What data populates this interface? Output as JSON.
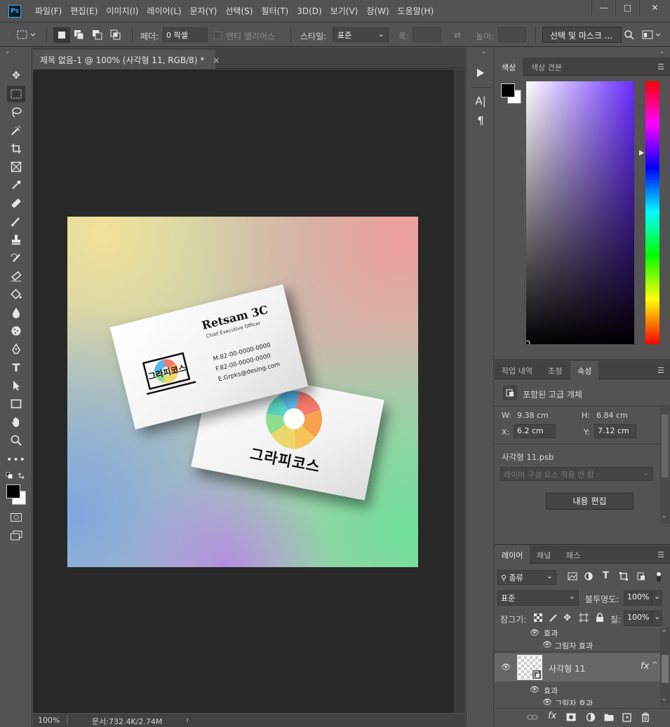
{
  "app": {
    "logo": "Ps",
    "menu": [
      "파일(F)",
      "편집(E)",
      "이미지(I)",
      "레이어(L)",
      "문자(Y)",
      "선택(S)",
      "필터(T)",
      "3D(D)",
      "보기(V)",
      "창(W)",
      "도움말(H)"
    ],
    "window_controls": [
      "—",
      "□",
      "✕"
    ]
  },
  "options_bar": {
    "feather_label": "페더:",
    "feather_value": "0 픽셀",
    "antialias_label": "앤티 앨리어스",
    "style_label": "스타일:",
    "style_value": "표준",
    "width_label": "폭:",
    "height_label": "높이:",
    "select_mask_button": "선택 및 마스크 ..."
  },
  "document": {
    "tab_title": "제목 없음-1 @ 100% (사각형 11, RGB/8) *",
    "tab_close": "×",
    "zoom": "100%",
    "doc_size": "문서:732.4K/2.74M",
    "status_arrow": "›"
  },
  "artwork": {
    "front_card": {
      "name": "Retsam 3C",
      "title": "Chief Executive Officer",
      "mobile": "M.82-00-0000-0000",
      "fax": "F.82-00-0000-0000",
      "email": "E.Grpks@desing.com",
      "logo_text": "그라피코스"
    },
    "back_card": {
      "logo_text": "그라피코스"
    }
  },
  "color_panel": {
    "tabs": [
      "색상",
      "색상 견본"
    ]
  },
  "properties_panel": {
    "tabs": [
      "작업 내역",
      "조정",
      "속성"
    ],
    "object_type": "포함된 고급 개체",
    "w_label": "W:",
    "w_value": "9.38 cm",
    "h_label": "H:",
    "h_value": "6.84 cm",
    "x_label": "X:",
    "x_value": "6.2 cm",
    "y_label": "Y:",
    "y_value": "7.12 cm",
    "file_name": "사각형 11.psb",
    "comp_select": "레이어 구성 요소 적용 안 함",
    "edit_button": "내용 편집"
  },
  "layers_panel": {
    "tabs": [
      "레이어",
      "채널",
      "패스"
    ],
    "filter_select": "종류",
    "blend_mode": "표준",
    "opacity_label": "불투명도:",
    "opacity_value": "100%",
    "lock_label": "잠그기:",
    "fill_label": "칠:",
    "fill_value": "100%",
    "rows": [
      {
        "label": "효과"
      },
      {
        "label": "그림자 효과"
      },
      {
        "label": "사각형 11"
      },
      {
        "label": "효과"
      },
      {
        "label": "그림자 효과"
      }
    ],
    "fx": "fx"
  }
}
